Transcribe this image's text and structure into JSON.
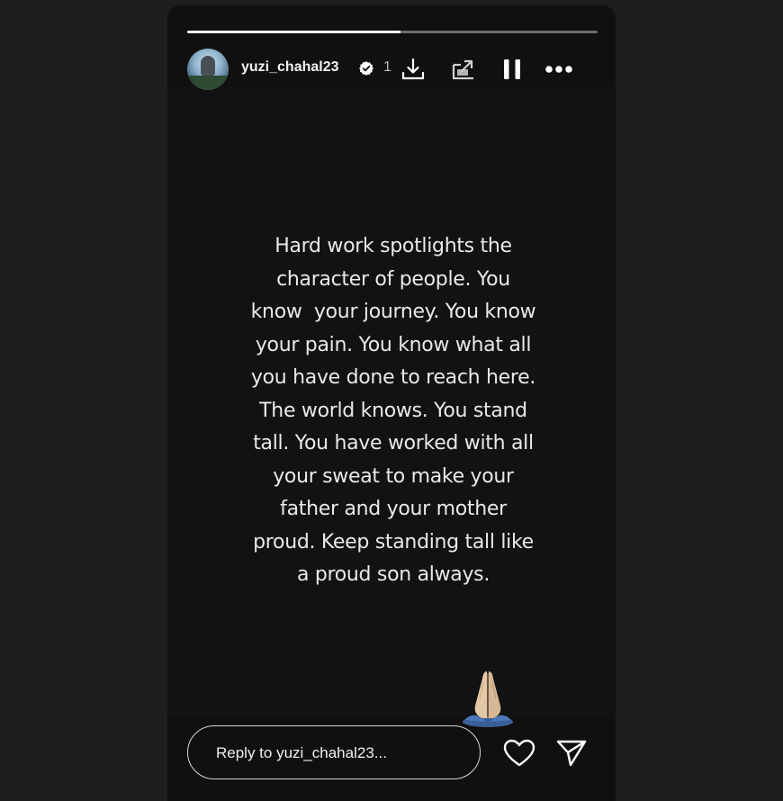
{
  "story": {
    "progress": 0.52,
    "user": {
      "username": "yuzi_chahal23",
      "verified": true,
      "time": "1"
    },
    "header_icons": [
      "download-icon",
      "save-to-device-icon",
      "pause-icon",
      "more-options-icon"
    ],
    "text": "Hard work spotlights the character of people. You know  your journey. You know your pain. You know what all you have done to reach here. The world knows. You stand tall. You have worked with all your sweat to make your father and your mother proud. Keep standing tall like a proud son always.",
    "text_lines": [
      "Hard work spotlights the",
      "character of people. You",
      "know  your journey. You know",
      "your pain. You know what all",
      "you have done to reach here.",
      "The world knows. You stand",
      "tall. You have worked with all",
      "your sweat to make your",
      "father and your mother",
      "proud. Keep standing tall like",
      "a proud son always."
    ],
    "sticker": "folded-hands-emoji"
  },
  "reply": {
    "placeholder": "Reply to yuzi_chahal23..."
  },
  "actions": [
    "like-icon",
    "share-icon"
  ],
  "colors": {
    "background": "#1d1d1e",
    "story_bg": "#101010",
    "text": "#e9e9e9",
    "verified_badge": "#ffffff"
  }
}
